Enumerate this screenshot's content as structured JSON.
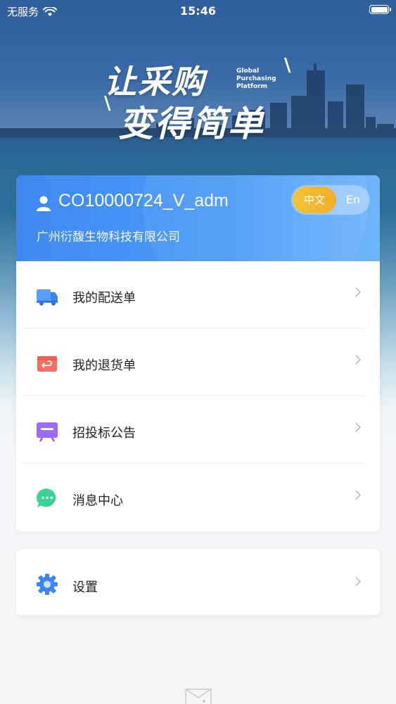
{
  "status_bar": {
    "carrier": "无服务",
    "time": "15:46"
  },
  "banner": {
    "slogan_line1": "让采购",
    "slogan_line2": "变得简单",
    "tagline": [
      "Global",
      "Purchasing",
      "Platform"
    ]
  },
  "user": {
    "username": "CO10000724_V_adm",
    "company": "广州衍馥生物科技有限公司"
  },
  "language": {
    "zh_label": "中文",
    "en_label": "En",
    "selected": "中文"
  },
  "menu": [
    {
      "label": "我的配送单",
      "icon": "delivery-truck-icon",
      "color": "#3b86f6"
    },
    {
      "label": "我的退货单",
      "icon": "return-box-icon",
      "color": "#f25d4f"
    },
    {
      "label": "招投标公告",
      "icon": "bidding-board-icon",
      "color": "#8a5cf0"
    },
    {
      "label": "消息中心",
      "icon": "message-bubble-icon",
      "color": "#2fc98b"
    }
  ],
  "settings": {
    "label": "设置",
    "icon": "gear-icon",
    "color": "#3b86f6"
  }
}
